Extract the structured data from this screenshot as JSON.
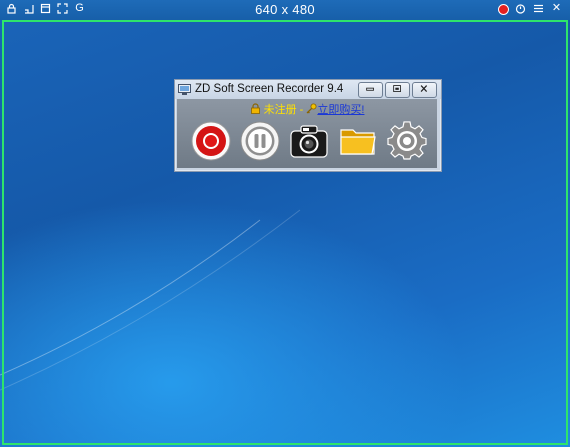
{
  "capture_frame": {
    "size_label": "640 x 480",
    "left_icons": [
      "lock-icon",
      "resize-icon",
      "window-icon",
      "fullscreen-icon",
      "g-icon"
    ],
    "left_glyphs": [
      "G"
    ],
    "right_icons": [
      "stop-record-icon",
      "timer-icon",
      "list-icon",
      "close-icon"
    ],
    "close_glyph": "✕",
    "border_color": "#2ee46b"
  },
  "recorder_window": {
    "title": "ZD Soft Screen Recorder 9.4",
    "buttons": [
      "minimize-button",
      "restore-button",
      "close-button"
    ],
    "registration": {
      "unregistered_text": "未注册",
      "separator": " - ",
      "buy_text": "立即购买!"
    },
    "tools": [
      "record-button",
      "pause-button",
      "screenshot-button",
      "open-folder-button",
      "settings-button"
    ]
  },
  "colors": {
    "desktop": "#1565b5",
    "record_red": "#d41414",
    "unregistered_yellow": "#ffe100",
    "buy_link_blue": "#1a37d6"
  }
}
